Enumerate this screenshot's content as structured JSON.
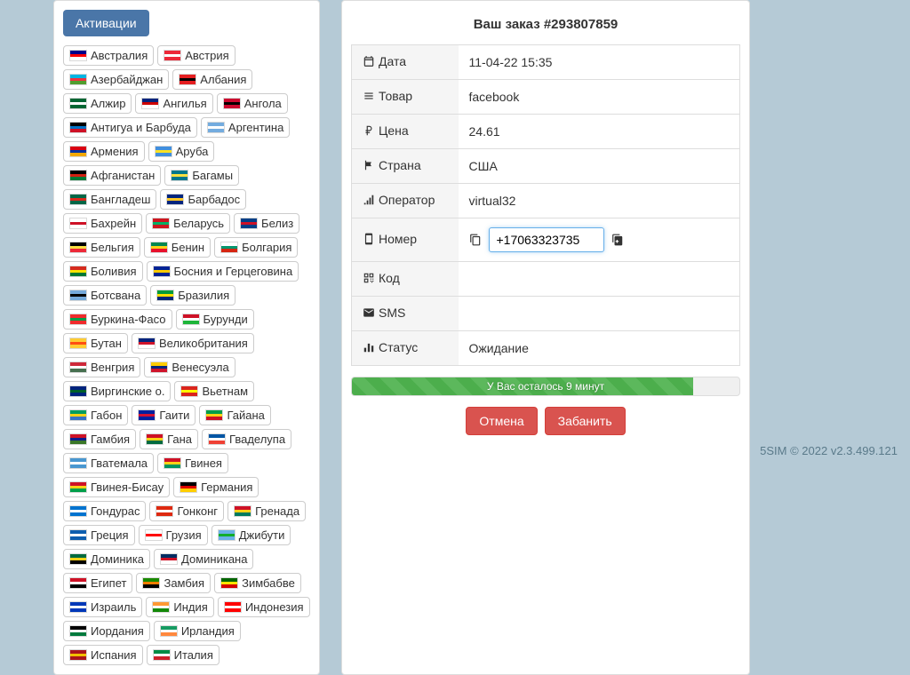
{
  "tabs": {
    "activations": "Активации"
  },
  "countries": [
    {
      "name": "Австралия",
      "flag": "au"
    },
    {
      "name": "Австрия",
      "flag": "at"
    },
    {
      "name": "Азербайджан",
      "flag": "az"
    },
    {
      "name": "Албания",
      "flag": "al"
    },
    {
      "name": "Алжир",
      "flag": "dz"
    },
    {
      "name": "Ангилья",
      "flag": "ai"
    },
    {
      "name": "Ангола",
      "flag": "ao"
    },
    {
      "name": "Антигуа и Барбуда",
      "flag": "ag"
    },
    {
      "name": "Аргентина",
      "flag": "ar"
    },
    {
      "name": "Армения",
      "flag": "am"
    },
    {
      "name": "Аруба",
      "flag": "aw"
    },
    {
      "name": "Афганистан",
      "flag": "af"
    },
    {
      "name": "Багамы",
      "flag": "bs"
    },
    {
      "name": "Бангладеш",
      "flag": "bd"
    },
    {
      "name": "Барбадос",
      "flag": "bb"
    },
    {
      "name": "Бахрейн",
      "flag": "bh"
    },
    {
      "name": "Беларусь",
      "flag": "by"
    },
    {
      "name": "Белиз",
      "flag": "bz"
    },
    {
      "name": "Бельгия",
      "flag": "be"
    },
    {
      "name": "Бенин",
      "flag": "bj"
    },
    {
      "name": "Болгария",
      "flag": "bg"
    },
    {
      "name": "Боливия",
      "flag": "bo"
    },
    {
      "name": "Босния и Герцеговина",
      "flag": "ba"
    },
    {
      "name": "Ботсвана",
      "flag": "bw"
    },
    {
      "name": "Бразилия",
      "flag": "br"
    },
    {
      "name": "Буркина-Фасо",
      "flag": "bf"
    },
    {
      "name": "Бурунди",
      "flag": "bi"
    },
    {
      "name": "Бутан",
      "flag": "bt"
    },
    {
      "name": "Великобритания",
      "flag": "gb"
    },
    {
      "name": "Венгрия",
      "flag": "hu"
    },
    {
      "name": "Венесуэла",
      "flag": "ve"
    },
    {
      "name": "Виргинские о.",
      "flag": "vg"
    },
    {
      "name": "Вьетнам",
      "flag": "vn"
    },
    {
      "name": "Габон",
      "flag": "ga"
    },
    {
      "name": "Гаити",
      "flag": "ht"
    },
    {
      "name": "Гайана",
      "flag": "gy"
    },
    {
      "name": "Гамбия",
      "flag": "gm"
    },
    {
      "name": "Гана",
      "flag": "gh"
    },
    {
      "name": "Гваделупа",
      "flag": "gp"
    },
    {
      "name": "Гватемала",
      "flag": "gt"
    },
    {
      "name": "Гвинея",
      "flag": "gn"
    },
    {
      "name": "Гвинея-Бисау",
      "flag": "gw"
    },
    {
      "name": "Германия",
      "flag": "de"
    },
    {
      "name": "Гондурас",
      "flag": "hn"
    },
    {
      "name": "Гонконг",
      "flag": "hk"
    },
    {
      "name": "Гренада",
      "flag": "gd"
    },
    {
      "name": "Греция",
      "flag": "gr"
    },
    {
      "name": "Грузия",
      "flag": "ge"
    },
    {
      "name": "Джибути",
      "flag": "dj"
    },
    {
      "name": "Доминика",
      "flag": "dm"
    },
    {
      "name": "Доминикана",
      "flag": "do"
    },
    {
      "name": "Египет",
      "flag": "eg"
    },
    {
      "name": "Замбия",
      "flag": "zm"
    },
    {
      "name": "Зимбабве",
      "flag": "zw"
    },
    {
      "name": "Израиль",
      "flag": "il"
    },
    {
      "name": "Индия",
      "flag": "in"
    },
    {
      "name": "Индонезия",
      "flag": "id"
    },
    {
      "name": "Иордания",
      "flag": "jo"
    },
    {
      "name": "Ирландия",
      "flag": "ie"
    },
    {
      "name": "Испания",
      "flag": "es"
    },
    {
      "name": "Италия",
      "flag": "it"
    }
  ],
  "flag_colors": {
    "au": [
      "#00008B",
      "#FF0000",
      "#FFF"
    ],
    "at": [
      "#ED2939",
      "#FFF",
      "#ED2939"
    ],
    "az": [
      "#00B5E2",
      "#EF3340",
      "#509E2F"
    ],
    "al": [
      "#E41E20",
      "#000",
      "#E41E20"
    ],
    "dz": [
      "#006633",
      "#FFF",
      "#006633"
    ],
    "ai": [
      "#00247D",
      "#CC0000",
      "#FFF"
    ],
    "ao": [
      "#CC092F",
      "#000",
      "#CC092F"
    ],
    "ag": [
      "#000",
      "#0072C6",
      "#CE1126"
    ],
    "ar": [
      "#74ACDF",
      "#FFF",
      "#74ACDF"
    ],
    "am": [
      "#D90012",
      "#0033A0",
      "#F2A800"
    ],
    "aw": [
      "#418FDE",
      "#FBE122",
      "#418FDE"
    ],
    "af": [
      "#000",
      "#D32011",
      "#007A36"
    ],
    "bs": [
      "#00778B",
      "#FAE042",
      "#00778B"
    ],
    "bd": [
      "#006747",
      "#DA291C",
      "#006747"
    ],
    "bb": [
      "#00267F",
      "#FFC726",
      "#00267F"
    ],
    "bh": [
      "#FFF",
      "#CE1126",
      "#FFF"
    ],
    "by": [
      "#CE1720",
      "#00AF66",
      "#CE1720"
    ],
    "bz": [
      "#003F87",
      "#CE1126",
      "#003F87"
    ],
    "be": [
      "#000",
      "#FAE042",
      "#ED2939"
    ],
    "bj": [
      "#008751",
      "#FCD116",
      "#E8112D"
    ],
    "bg": [
      "#FFF",
      "#00966E",
      "#D62612"
    ],
    "bo": [
      "#D52B1E",
      "#F9E300",
      "#007934"
    ],
    "ba": [
      "#002395",
      "#FECB00",
      "#002395"
    ],
    "bw": [
      "#75AADB",
      "#000",
      "#75AADB"
    ],
    "br": [
      "#009B3A",
      "#FEDF00",
      "#002776"
    ],
    "bf": [
      "#EF2B2D",
      "#009E49",
      "#EF2B2D"
    ],
    "bi": [
      "#CE1126",
      "#FFF",
      "#1EB53A"
    ],
    "bt": [
      "#FFCC33",
      "#FF4E12",
      "#FFCC33"
    ],
    "gb": [
      "#00247D",
      "#CF142B",
      "#FFF"
    ],
    "hu": [
      "#CE2939",
      "#FFF",
      "#477050"
    ],
    "ve": [
      "#FFCC00",
      "#00247D",
      "#CF142B"
    ],
    "vg": [
      "#00247D",
      "#006129",
      "#00247D"
    ],
    "vn": [
      "#DA251D",
      "#FFFF00",
      "#DA251D"
    ],
    "ga": [
      "#009E60",
      "#FCD116",
      "#3A75C4"
    ],
    "ht": [
      "#00209F",
      "#D21034",
      "#00209F"
    ],
    "gy": [
      "#009E49",
      "#FCD116",
      "#CE1126"
    ],
    "gm": [
      "#CE1126",
      "#0C1C8C",
      "#3A7728"
    ],
    "gh": [
      "#CE1126",
      "#FCD116",
      "#006B3F"
    ],
    "gp": [
      "#0055A4",
      "#FFF",
      "#EF4135"
    ],
    "gt": [
      "#4997D0",
      "#FFF",
      "#4997D0"
    ],
    "gn": [
      "#CE1126",
      "#FCD116",
      "#009460"
    ],
    "gw": [
      "#CE1126",
      "#FCD116",
      "#009E49"
    ],
    "de": [
      "#000",
      "#DD0000",
      "#FFCE00"
    ],
    "hn": [
      "#0073CF",
      "#FFF",
      "#0073CF"
    ],
    "hk": [
      "#DE2910",
      "#FFF",
      "#DE2910"
    ],
    "gd": [
      "#CE1126",
      "#FCD116",
      "#007A5E"
    ],
    "gr": [
      "#0D5EAF",
      "#FFF",
      "#0D5EAF"
    ],
    "ge": [
      "#FFF",
      "#FF0000",
      "#FFF"
    ],
    "dj": [
      "#6AB2E7",
      "#12AD2B",
      "#6AB2E7"
    ],
    "dm": [
      "#006B3F",
      "#FCD116",
      "#000"
    ],
    "do": [
      "#002D62",
      "#CE1126",
      "#FFF"
    ],
    "eg": [
      "#CE1126",
      "#FFF",
      "#000"
    ],
    "zm": [
      "#198A00",
      "#EF7D00",
      "#000"
    ],
    "zw": [
      "#006400",
      "#FCE300",
      "#D40000"
    ],
    "il": [
      "#0038B8",
      "#FFF",
      "#0038B8"
    ],
    "in": [
      "#FF9933",
      "#FFF",
      "#138808"
    ],
    "id": [
      "#FF0000",
      "#FFF",
      "#FF0000"
    ],
    "jo": [
      "#000",
      "#FFF",
      "#007A3D"
    ],
    "ie": [
      "#169B62",
      "#FFF",
      "#FF883E"
    ],
    "es": [
      "#AA151B",
      "#F1BF00",
      "#AA151B"
    ],
    "it": [
      "#008C45",
      "#FFF",
      "#CD212A"
    ]
  },
  "order": {
    "title_prefix": "Ваш заказ #",
    "id": "293807859",
    "labels": {
      "date": "Дата",
      "product": "Товар",
      "price": "Цена",
      "country": "Страна",
      "operator": "Оператор",
      "number": "Номер",
      "code": "Код",
      "sms": "SMS",
      "status": "Статус"
    },
    "values": {
      "date": "11-04-22 15:35",
      "product": "facebook",
      "price": "24.61",
      "country": "США",
      "operator": "virtual32",
      "number": "+17063323735",
      "code": "",
      "sms": "",
      "status": "Ожидание"
    },
    "progress_text": "У Вас осталось 9 минут",
    "progress_percent": 88,
    "actions": {
      "cancel": "Отмена",
      "ban": "Забанить"
    }
  },
  "footer": "5SIM © 2022 v2.3.499.121"
}
